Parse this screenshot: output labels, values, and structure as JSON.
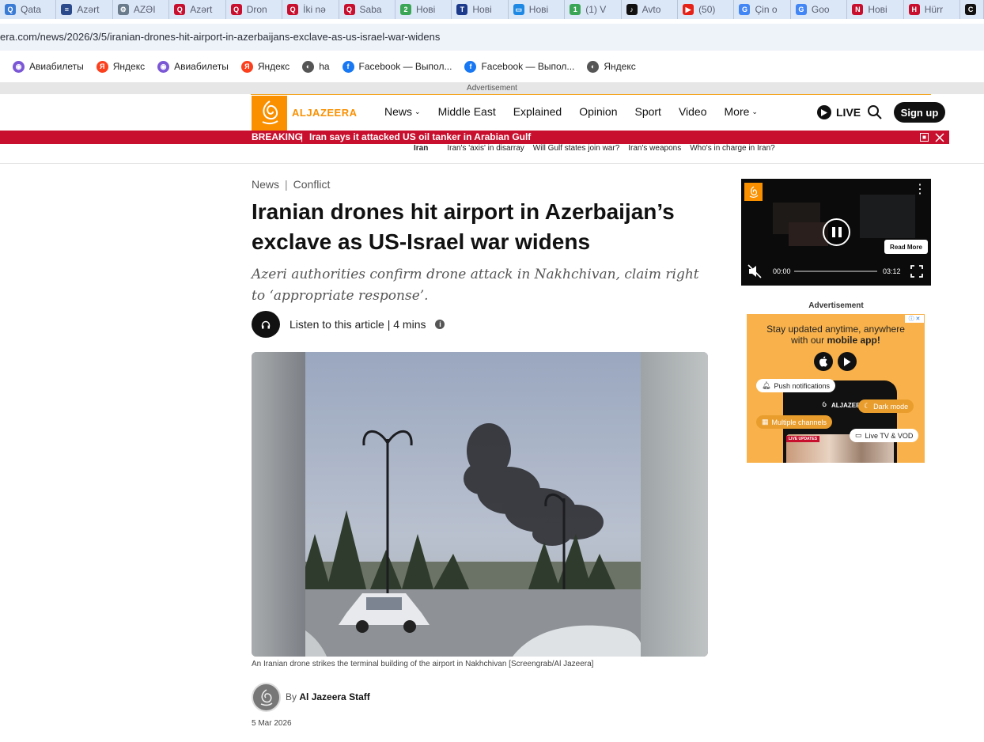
{
  "browser": {
    "tabs": [
      {
        "label": "Qata",
        "color": "#3a7bd5",
        "glyph": "Q"
      },
      {
        "label": "Azərt",
        "color": "#2b4a8b",
        "glyph": "≡"
      },
      {
        "label": "AZƏI",
        "color": "#6a7b8c",
        "glyph": "⚙"
      },
      {
        "label": "Azərt",
        "color": "#c8102e",
        "glyph": "Q"
      },
      {
        "label": "Dron",
        "color": "#c8102e",
        "glyph": "Q"
      },
      {
        "label": "İki nə",
        "color": "#c8102e",
        "glyph": "Q"
      },
      {
        "label": "Saba",
        "color": "#c8102e",
        "glyph": "Q"
      },
      {
        "label": "Нові",
        "color": "#3aa655",
        "glyph": "2"
      },
      {
        "label": "Нові",
        "color": "#1b3a8c",
        "glyph": "T"
      },
      {
        "label": "Нові",
        "color": "#1e88e5",
        "glyph": "▭"
      },
      {
        "label": "(1) V",
        "color": "#3aa655",
        "glyph": "1"
      },
      {
        "label": "Avto",
        "color": "#111111",
        "glyph": "♪"
      },
      {
        "label": "(50)",
        "color": "#e62117",
        "glyph": "▶"
      },
      {
        "label": "Çin o",
        "color": "#4285f4",
        "glyph": "G"
      },
      {
        "label": "Goo",
        "color": "#4285f4",
        "glyph": "G"
      },
      {
        "label": "Нові",
        "color": "#c8102e",
        "glyph": "N"
      },
      {
        "label": "Hürr",
        "color": "#c8102e",
        "glyph": "H"
      },
      {
        "label": "",
        "color": "#111111",
        "glyph": "C"
      }
    ],
    "url": "era.com/news/2026/3/5/iranian-drones-hit-airport-in-azerbaijans-exclave-as-us-israel-war-widens",
    "bookmarks": [
      {
        "label": "Авиабилеты",
        "icon": "globe-icon",
        "color": "#7b57d6",
        "glyph": "◉"
      },
      {
        "label": "Яндекс",
        "icon": "yandex-icon",
        "color": "#fc3f1d",
        "glyph": "Я"
      },
      {
        "label": "Авиабилеты",
        "icon": "globe-icon",
        "color": "#7b57d6",
        "glyph": "◉"
      },
      {
        "label": "Яндекс",
        "icon": "yandex-icon",
        "color": "#fc3f1d",
        "glyph": "Я"
      },
      {
        "label": "ha",
        "icon": "globe-icon",
        "color": "#555555",
        "glyph": "◐"
      },
      {
        "label": "Facebook — Выпол...",
        "icon": "facebook-icon",
        "color": "#1877f2",
        "glyph": "f"
      },
      {
        "label": "Facebook — Выпол...",
        "icon": "facebook-icon",
        "color": "#1877f2",
        "glyph": "f"
      },
      {
        "label": "Яндекс",
        "icon": "globe-icon",
        "color": "#555555",
        "glyph": "◐"
      }
    ]
  },
  "site": {
    "ad_label": "Advertisement",
    "brand": "ALJAZEERA",
    "brand_color": "#fa9000",
    "nav": [
      {
        "label": "News",
        "dropdown": true
      },
      {
        "label": "Middle East",
        "dropdown": false
      },
      {
        "label": "Explained",
        "dropdown": false
      },
      {
        "label": "Opinion",
        "dropdown": false
      },
      {
        "label": "Sport",
        "dropdown": false
      },
      {
        "label": "Video",
        "dropdown": false
      },
      {
        "label": "More",
        "dropdown": true
      }
    ],
    "live_label": "LIVE",
    "signup_label": "Sign up",
    "breaking": {
      "label": "BREAKING",
      "separator": "|",
      "text": "Iran says it attacked US oil tanker in Arabian Gulf",
      "color": "#c8102e"
    },
    "subnav": {
      "topic": "Iran",
      "links": [
        "Iran's 'axis' in disarray",
        "Will Gulf states join war?",
        "Iran's weapons",
        "Who's in charge in Iran?"
      ]
    }
  },
  "article": {
    "crumb_1": "News",
    "crumb_sep": "|",
    "crumb_2": "Conflict",
    "title": "Iranian drones hit airport in Azerbaijan’s exclave as US-Israel war widens",
    "subtitle": "Azeri authorities confirm drone attack in Nakhchivan, claim right to ‘appropriate response’.",
    "listen": "Listen to this article | 4 mins",
    "caption": "An Iranian drone strikes the terminal building of the airport in Nakhchivan [Screengrab/Al Jazeera]",
    "by": "By",
    "author": "Al Jazeera Staff",
    "date": "5 Mar 2026"
  },
  "sidebar": {
    "video": {
      "read_more": "Read More",
      "time_current": "00:00",
      "time_total": "03:12",
      "progress": 0
    },
    "ad_label": "Advertisement",
    "app_ad": {
      "headline_1": "Stay updated anytime, anywhere",
      "headline_2_pre": "with our ",
      "headline_2_bold": "mobile app!",
      "brand": "ALJAZEERA",
      "live_badge": "LIVE UPDATES",
      "pills": [
        "Push notifications",
        "Dark mode",
        "Multiple channels",
        "Live TV & VOD"
      ]
    }
  }
}
